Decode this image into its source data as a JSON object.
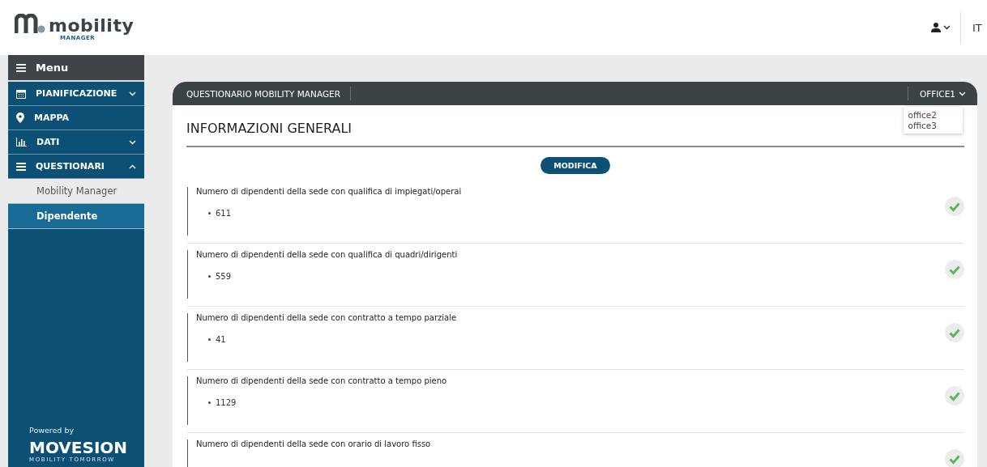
{
  "header": {
    "logo_text": "mobility",
    "logo_subtext": "MANAGER",
    "language": "IT"
  },
  "sidebar": {
    "title": "Menu",
    "items": [
      {
        "label": "PIANIFICAZIONE",
        "kind": "group",
        "expanded": false
      },
      {
        "label": "MAPPA",
        "kind": "link"
      },
      {
        "label": "DATI",
        "kind": "group",
        "expanded": false
      },
      {
        "label": "QUESTIONARI",
        "kind": "group",
        "expanded": true,
        "children": [
          {
            "label": "Mobility Manager",
            "selected": false
          },
          {
            "label": "Dipendente",
            "selected": true
          }
        ]
      }
    ],
    "powered_by": "Powered by",
    "brand": "MOVESION",
    "brand_tagline": "MOBILITY TOMORROW"
  },
  "card": {
    "title": "QUESTIONARIO MOBILITY MANAGER",
    "office_selector": {
      "value": "OFFICE1",
      "open": true,
      "options": [
        "office2",
        "office3"
      ]
    },
    "section_title": "INFORMAZIONI GENERALI",
    "edit_button": "MODIFICA",
    "questions": [
      {
        "text": "Numero di dipendenti della sede con qualifica di impiegati/operai",
        "answer": "611",
        "answered": true
      },
      {
        "text": "Numero di dipendenti della sede con qualifica di quadri/dirigenti",
        "answer": "559",
        "answered": true
      },
      {
        "text": "Numero di dipendenti della sede con contratto a tempo parziale",
        "answer": "41",
        "answered": true
      },
      {
        "text": "Numero di dipendenti della sede con contratto a tempo pieno",
        "answer": "1129",
        "answered": true
      },
      {
        "text": "Numero di dipendenti della sede con orario di lavoro fisso",
        "answered": true
      }
    ]
  }
}
